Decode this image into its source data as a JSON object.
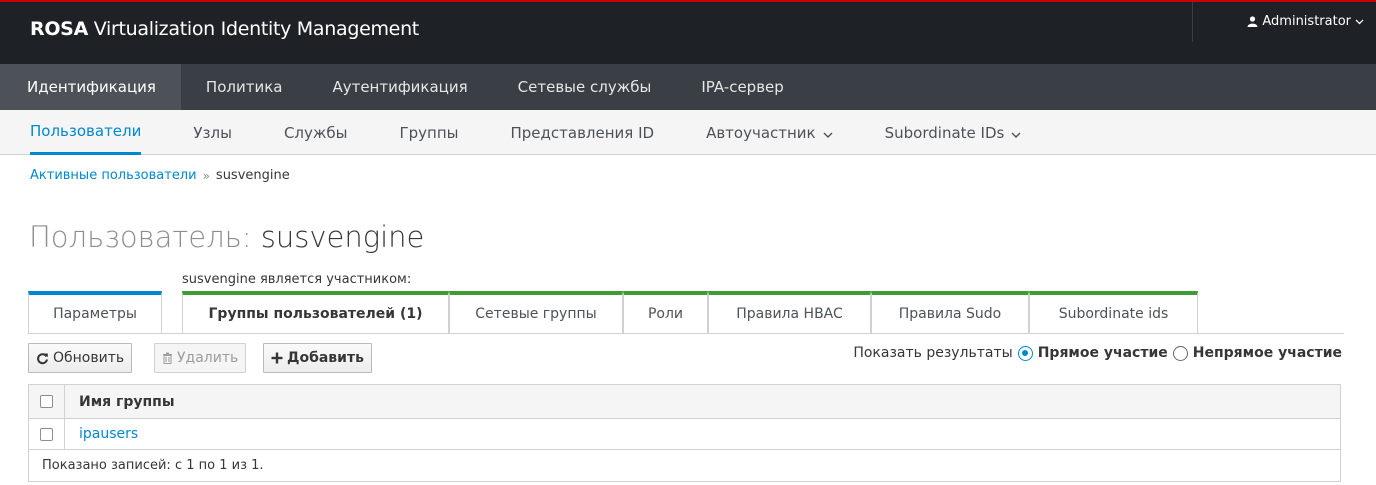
{
  "header": {
    "brand_bold": "ROSA",
    "brand_rest": " Virtualization Identity Management",
    "user": "Administrator"
  },
  "primary_nav": [
    {
      "label": "Идентификация",
      "active": true
    },
    {
      "label": "Политика"
    },
    {
      "label": "Аутентификация"
    },
    {
      "label": "Сетевые службы"
    },
    {
      "label": "IPA-сервер"
    }
  ],
  "secondary_nav": [
    {
      "label": "Пользователи",
      "active": true
    },
    {
      "label": "Узлы"
    },
    {
      "label": "Службы"
    },
    {
      "label": "Группы"
    },
    {
      "label": "Представления ID"
    },
    {
      "label": "Автоучастник",
      "dropdown": true
    },
    {
      "label": "Subordinate IDs",
      "dropdown": true
    }
  ],
  "breadcrumb": {
    "parent": "Активные пользователи",
    "separator": "»",
    "current": "susvengine"
  },
  "page": {
    "title_prefix": "Пользователь: ",
    "title_name": "susvengine",
    "member_of": "susvengine является участником:"
  },
  "tabs": [
    {
      "label": "Параметры"
    },
    {
      "label": "Группы пользователей (1)"
    },
    {
      "label": "Сетевые группы"
    },
    {
      "label": "Роли"
    },
    {
      "label": "Правила HBAC"
    },
    {
      "label": "Правила Sudo"
    },
    {
      "label": "Subordinate ids"
    }
  ],
  "toolbar": {
    "refresh": "Обновить",
    "delete": "Удалить",
    "add": "Добавить",
    "show_results": "Показать результаты",
    "direct": "Прямое участие",
    "indirect": "Непрямое участие"
  },
  "table": {
    "column": "Имя группы",
    "rows": [
      "ipausers"
    ],
    "footer": "Показано записей: с 1 по 1 из 1."
  },
  "colors": {
    "accent": "#0088ce",
    "green": "#3f9c35",
    "header_bg": "#1e2226",
    "nav_bg": "#393f44"
  }
}
